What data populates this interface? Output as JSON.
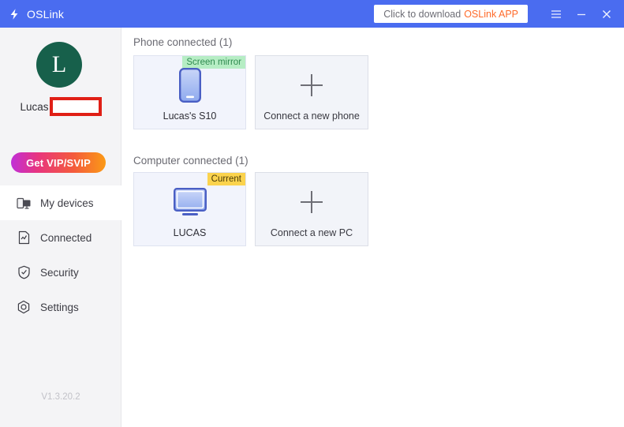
{
  "titlebar": {
    "app_title": "OSLink",
    "logo_icon": "lightning-bolt-icon",
    "download_button": {
      "text_main": "Click to download",
      "text_accent": "OSLink APP",
      "accent_color": "#ff6a2a"
    },
    "menu_icon": "hamburger-menu-icon",
    "minimize_icon": "minimize-icon",
    "close_icon": "close-icon",
    "background_color": "#4a6cf0"
  },
  "sidebar": {
    "avatar_initial": "L",
    "avatar_color": "#17604b",
    "username": "Lucas",
    "redacted_field": "",
    "vip_button_label": "Get VIP/SVIP",
    "nav_items": [
      {
        "label": "My devices",
        "icon": "devices-icon",
        "active": true
      },
      {
        "label": "Connected",
        "icon": "report-chart-icon",
        "active": false
      },
      {
        "label": "Security",
        "icon": "shield-check-icon",
        "active": false
      },
      {
        "label": "Settings",
        "icon": "gear-hexagon-icon",
        "active": false
      }
    ],
    "version": "V1.3.20.2"
  },
  "main": {
    "phone_section": {
      "title": "Phone connected (1)",
      "devices": [
        {
          "name": "Lucas's S10",
          "badge": "Screen mirror",
          "badge_bg": "#b6edc4",
          "badge_fg": "#2f8a50",
          "icon": "smartphone-icon"
        }
      ],
      "add_card": {
        "label": "Connect a new phone",
        "icon": "plus-icon"
      }
    },
    "computer_section": {
      "title": "Computer connected (1)",
      "devices": [
        {
          "name": "LUCAS",
          "badge": "Current",
          "badge_bg": "#fbd34d",
          "badge_fg": "#4a3b07",
          "icon": "monitor-icon"
        }
      ],
      "add_card": {
        "label": "Connect a new PC",
        "icon": "plus-icon"
      }
    }
  }
}
